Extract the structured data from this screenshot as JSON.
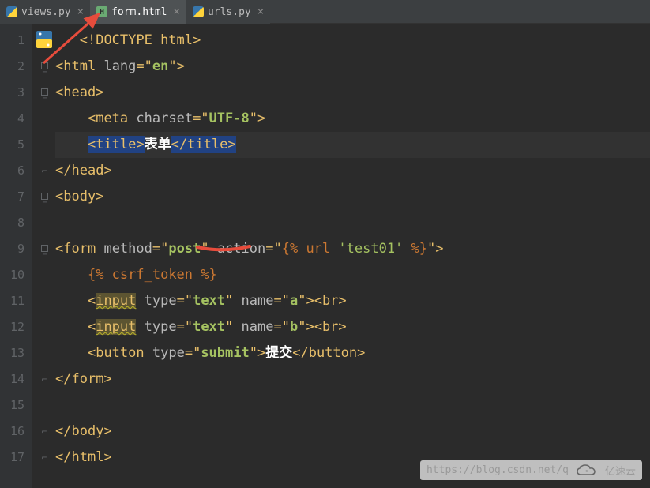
{
  "tabs": [
    {
      "label": "views.py",
      "type": "py",
      "active": false
    },
    {
      "label": "form.html",
      "type": "html",
      "active": true
    },
    {
      "label": "urls.py",
      "type": "py",
      "active": false
    }
  ],
  "lines": {
    "count": 17,
    "current": 5
  },
  "code": {
    "l1_doctype": "DOCTYPE html",
    "l2_tag": "html",
    "l2_attr": "lang",
    "l2_val": "en",
    "l3_tag": "head",
    "l4_tag": "meta",
    "l4_attr": "charset",
    "l4_val": "UTF-8",
    "l5_tag": "title",
    "l5_text": "表单",
    "l6_tag": "head",
    "l7_tag": "body",
    "l9_tag": "form",
    "l9_attr1": "method",
    "l9_val1": "post",
    "l9_attr2": "action",
    "l9_django_fn": "url",
    "l9_django_arg": "'test01'",
    "l10_django": "csrf_token",
    "l11_tag": "input",
    "l11_attr1": "type",
    "l11_val1": "text",
    "l11_attr2": "name",
    "l11_val2": "a",
    "l11_br": "br",
    "l12_tag": "input",
    "l12_attr1": "type",
    "l12_val1": "text",
    "l12_attr2": "name",
    "l12_val2": "b",
    "l12_br": "br",
    "l13_tag": "button",
    "l13_attr": "type",
    "l13_val": "submit",
    "l13_text": "提交",
    "l14_tag": "form",
    "l16_tag": "body",
    "l17_tag": "html"
  },
  "watermark": {
    "url": "https://blog.csdn.net/q",
    "brand": "亿速云"
  }
}
